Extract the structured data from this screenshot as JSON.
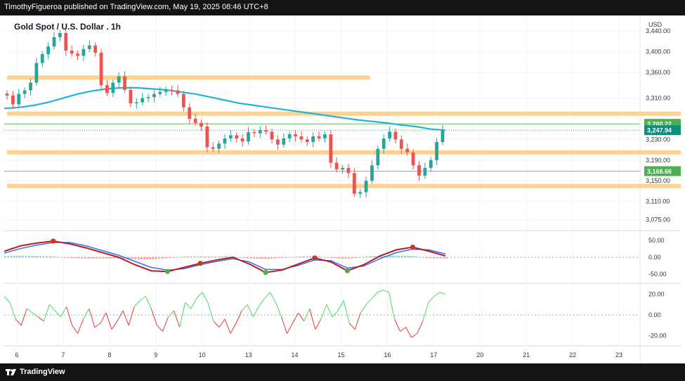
{
  "header": {
    "attribution": "TimothyFigueroa published on TradingView.com, May 19, 2025 08:46 UTC+8"
  },
  "footer": {
    "brand": "TradingView",
    "logo_icon": "tradingview-logo-icon"
  },
  "chart_data": [
    {
      "type": "candlestick",
      "title": "Gold Spot / U.S. Dollar . 1h",
      "currency_label": "USD",
      "ylim": [
        3055,
        3470
      ],
      "y_ticks": [
        "3,440.00",
        "3,400.00",
        "3,360.00",
        "3,310.00",
        "3,260.00",
        "3,230.00",
        "3,190.00",
        "3,150.00",
        "3,110.00",
        "3,075.00"
      ],
      "x_ticks": [
        "6",
        "7",
        "8",
        "9",
        "10",
        "13",
        "14",
        "15",
        "16",
        "17",
        "20",
        "21",
        "22",
        "23"
      ],
      "price_labels": [
        {
          "text": "3,260.22",
          "value": 3260.22,
          "color": "#4caf50"
        },
        {
          "text": "3,247.94",
          "value": 3247.94,
          "color": "#0d8f7f"
        },
        {
          "text": "3,168.66",
          "value": 3168.66,
          "color": "#4caf50"
        }
      ],
      "horizontal_lines": [
        {
          "value": 3260.22,
          "color": "#4caf50"
        },
        {
          "value": 3168.66,
          "color": "#4caf50"
        },
        {
          "value": 3247.94,
          "color": "#0d8f7f",
          "dotted": true
        }
      ],
      "zones": [
        {
          "from": 3348,
          "to": 3354,
          "start_index": 0,
          "end_index": 60
        },
        {
          "from": 3278,
          "to": 3284,
          "start_index": 0,
          "end_index": 118
        },
        {
          "from": 3203,
          "to": 3209,
          "start_index": 0,
          "end_index": 118
        },
        {
          "from": 3138,
          "to": 3144,
          "start_index": 0,
          "end_index": 118
        }
      ],
      "ohlc_key_closes": [
        3315,
        3298,
        3318,
        3325,
        3340,
        3378,
        3395,
        3410,
        3428,
        3436,
        3402,
        3396,
        3392,
        3405,
        3412,
        3398,
        3335,
        3320,
        3340,
        3352,
        3326,
        3300,
        3302,
        3310,
        3312,
        3318,
        3322,
        3326,
        3325,
        3318,
        3292,
        3270,
        3262,
        3255,
        3215,
        3212,
        3222,
        3232,
        3238,
        3232,
        3226,
        3244,
        3242,
        3248,
        3245,
        3230,
        3220,
        3232,
        3240,
        3236,
        3230,
        3225,
        3236,
        3232,
        3240,
        3185,
        3172,
        3175,
        3165,
        3125,
        3128,
        3150,
        3180,
        3212,
        3232,
        3245,
        3230,
        3212,
        3205,
        3180,
        3160,
        3175,
        3190,
        3225,
        3249
      ],
      "ma_curve": [
        3290,
        3292,
        3296,
        3302,
        3310,
        3318,
        3324,
        3328,
        3330,
        3330,
        3328,
        3326,
        3322,
        3318,
        3312,
        3306,
        3300,
        3296,
        3292,
        3288,
        3284,
        3280,
        3276,
        3272,
        3268,
        3265,
        3262,
        3258,
        3255,
        3250,
        3248
      ],
      "oscillator": {
        "ylim": [
          -75,
          75
        ],
        "y_ticks": [
          "50.00",
          "0.00",
          "-50.00"
        ],
        "fast_line": [
          18,
          34,
          42,
          48,
          40,
          28,
          14,
          0,
          -22,
          -40,
          -42,
          -30,
          -18,
          -8,
          0,
          -20,
          -45,
          -38,
          -20,
          -2,
          -14,
          -40,
          -22,
          4,
          22,
          30,
          18,
          4
        ],
        "slow_line": [
          12,
          26,
          36,
          44,
          44,
          34,
          20,
          6,
          -12,
          -30,
          -38,
          -34,
          -22,
          -12,
          -4,
          -14,
          -36,
          -36,
          -24,
          -8,
          -10,
          -32,
          -26,
          -4,
          14,
          24,
          22,
          10
        ],
        "signal_dots": [
          {
            "point_index": 3,
            "color": "#c0392b"
          },
          {
            "point_index": 10,
            "color": "#4caf50"
          },
          {
            "point_index": 12,
            "color": "#c0392b"
          },
          {
            "point_index": 16,
            "color": "#4caf50"
          },
          {
            "point_index": 19,
            "color": "#c0392b"
          },
          {
            "point_index": 21,
            "color": "#4caf50"
          },
          {
            "point_index": 25,
            "color": "#c0392b"
          }
        ]
      },
      "momentum": {
        "ylim": [
          -30,
          30
        ],
        "y_ticks": [
          "20.00",
          "0.00",
          "-20.00"
        ],
        "values": [
          18,
          12,
          -4,
          -10,
          6,
          2,
          -2,
          -6,
          10,
          4,
          -2,
          8,
          -10,
          -18,
          -4,
          6,
          -12,
          -8,
          2,
          -14,
          -6,
          4,
          -10,
          8,
          14,
          18,
          6,
          -10,
          -16,
          -2,
          4,
          -12,
          12,
          6,
          16,
          22,
          12,
          -6,
          -12,
          -4,
          -18,
          -8,
          4,
          10,
          -2,
          8,
          16,
          22,
          12,
          -2,
          -18,
          -8,
          2,
          -6,
          6,
          -14,
          -4,
          10,
          -2,
          4,
          14,
          -8,
          -14,
          2,
          10,
          16,
          22,
          24,
          22,
          -4,
          -16,
          -12,
          -22,
          -18,
          -6,
          12,
          18,
          22,
          20
        ]
      }
    }
  ]
}
